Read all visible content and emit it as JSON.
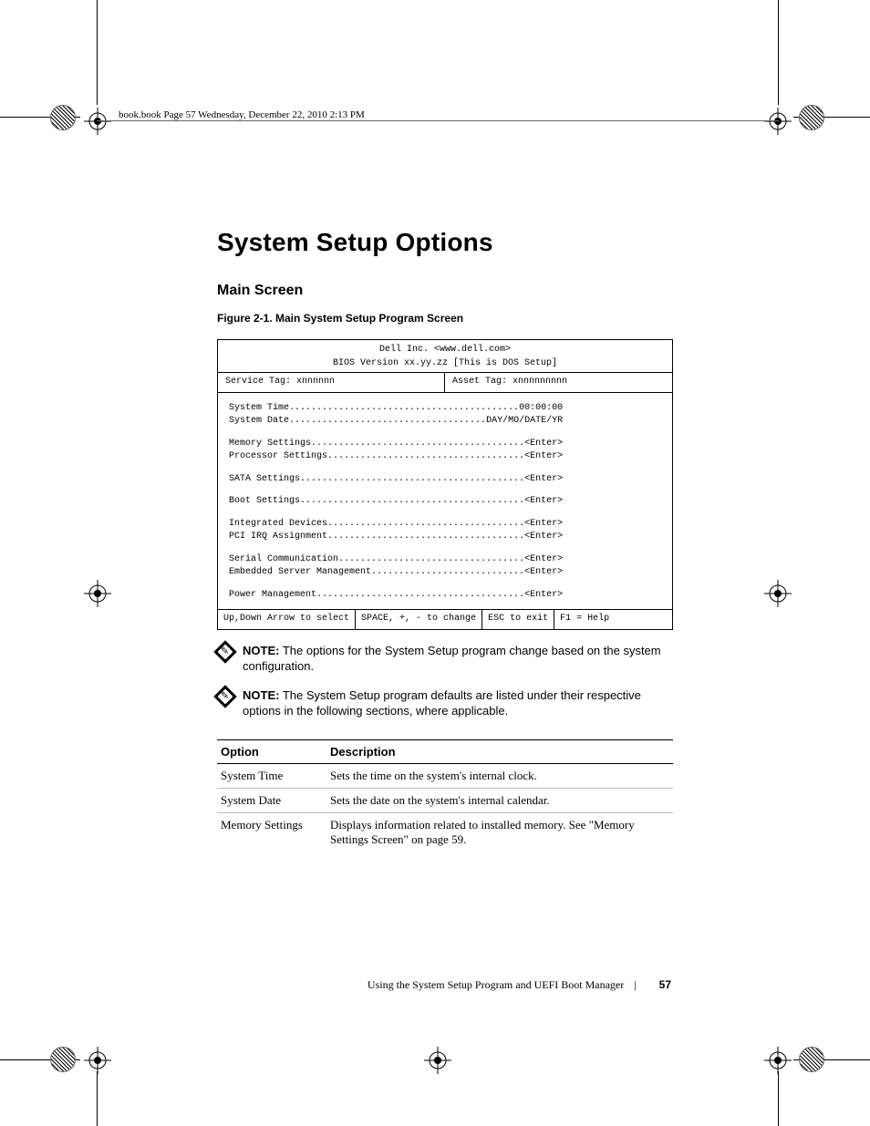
{
  "header_text": "book.book  Page 57  Wednesday, December 22, 2010  2:13 PM",
  "title": "System Setup Options",
  "subtitle": "Main Screen",
  "figure_caption": "Figure 2-1.   Main System Setup Program Screen",
  "bios": {
    "vendor": "Dell Inc. <www.dell.com>",
    "version": "BIOS Version xx.yy.zz [This is DOS Setup]",
    "service_tag_label": "Service Tag: xnnnnnn",
    "asset_tag_label": "Asset Tag: xnnnnnnnnn",
    "rows": [
      [
        {
          "label": "System Time",
          "dots": "..........................................",
          "value": "00:00:00"
        },
        {
          "label": "System Date",
          "dots": "....................................",
          "value": "DAY/MO/DATE/YR"
        }
      ],
      [
        {
          "label": "Memory Settings",
          "dots": ".......................................",
          "value": "<Enter>"
        },
        {
          "label": "Processor Settings",
          "dots": "....................................",
          "value": "<Enter>"
        }
      ],
      [
        {
          "label": "SATA Settings",
          "dots": ".........................................",
          "value": "<Enter>"
        }
      ],
      [
        {
          "label": "Boot Settings",
          "dots": ".........................................",
          "value": "<Enter>"
        }
      ],
      [
        {
          "label": "Integrated Devices",
          "dots": "....................................",
          "value": "<Enter>"
        },
        {
          "label": "PCI IRQ Assignment",
          "dots": "....................................",
          "value": "<Enter>"
        }
      ],
      [
        {
          "label": "Serial Communication",
          "dots": "..................................",
          "value": "<Enter>"
        },
        {
          "label": "Embedded Server Management",
          "dots": "............................",
          "value": "<Enter>"
        }
      ],
      [
        {
          "label": "Power Management",
          "dots": "......................................",
          "value": "<Enter>"
        }
      ]
    ],
    "footer": {
      "nav": "Up,Down Arrow to select",
      "change": "SPACE, +, - to change",
      "exit": "ESC to exit",
      "help": "F1 = Help"
    }
  },
  "notes": [
    {
      "label": "NOTE:",
      "text": " The options for the System Setup program change based on the system configuration."
    },
    {
      "label": "NOTE:",
      "text": " The System Setup program defaults are listed under their respective options in the following sections, where applicable."
    }
  ],
  "table": {
    "headers": {
      "option": "Option",
      "description": "Description"
    },
    "rows": [
      {
        "option": "System Time",
        "description": "Sets the time on the system's internal clock."
      },
      {
        "option": "System Date",
        "description": "Sets the date on the system's internal calendar."
      },
      {
        "option": "Memory Settings",
        "description": "Displays information related to installed memory. See \"Memory Settings Screen\" on page 59."
      }
    ]
  },
  "footer": {
    "section": "Using the System Setup Program and UEFI Boot Manager",
    "page": "57"
  }
}
